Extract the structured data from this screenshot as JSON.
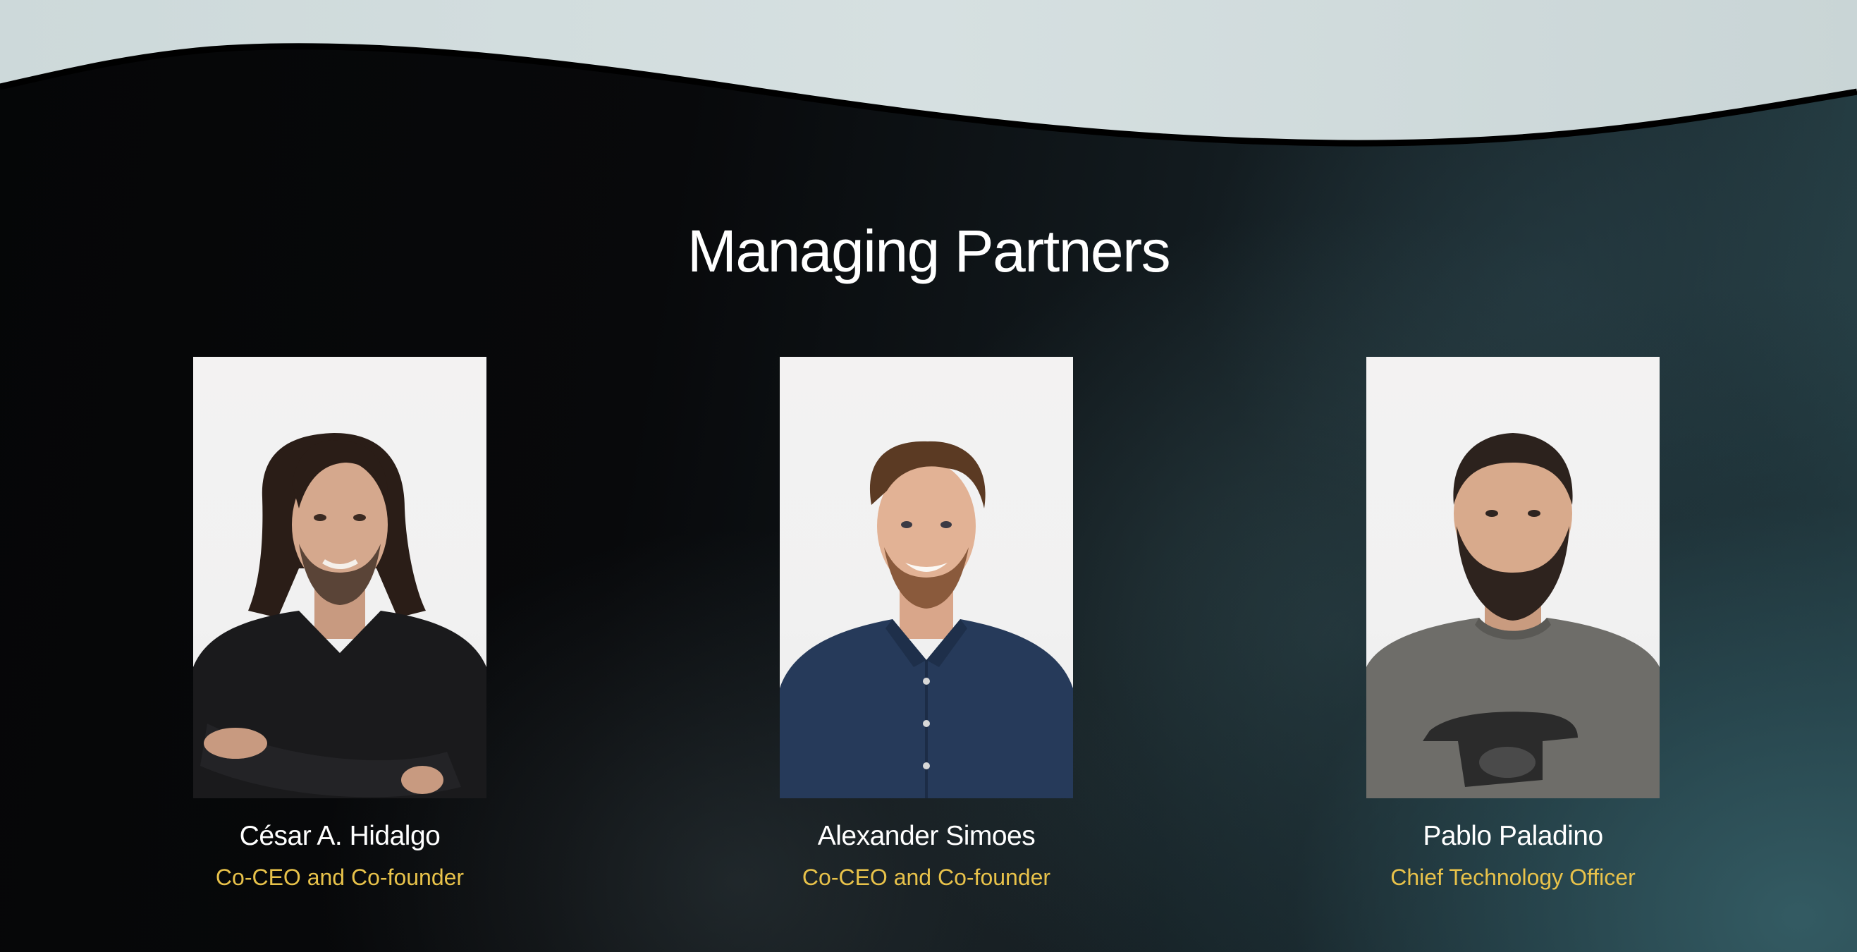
{
  "section": {
    "title": "Managing Partners"
  },
  "partners": [
    {
      "name": "César A. Hidalgo",
      "role": "Co-CEO and Co-founder",
      "photo_icon": "portrait-photo"
    },
    {
      "name": "Alexander Simoes",
      "role": "Co-CEO and Co-founder",
      "photo_icon": "portrait-photo"
    },
    {
      "name": "Pablo Paladino",
      "role": "Chief Technology Officer",
      "photo_icon": "portrait-photo"
    }
  ],
  "colors": {
    "role_text": "#e8c24a",
    "title_text": "#ffffff",
    "wave_top": "#cfdbdc",
    "photo_bg": "#f2f2f2"
  }
}
